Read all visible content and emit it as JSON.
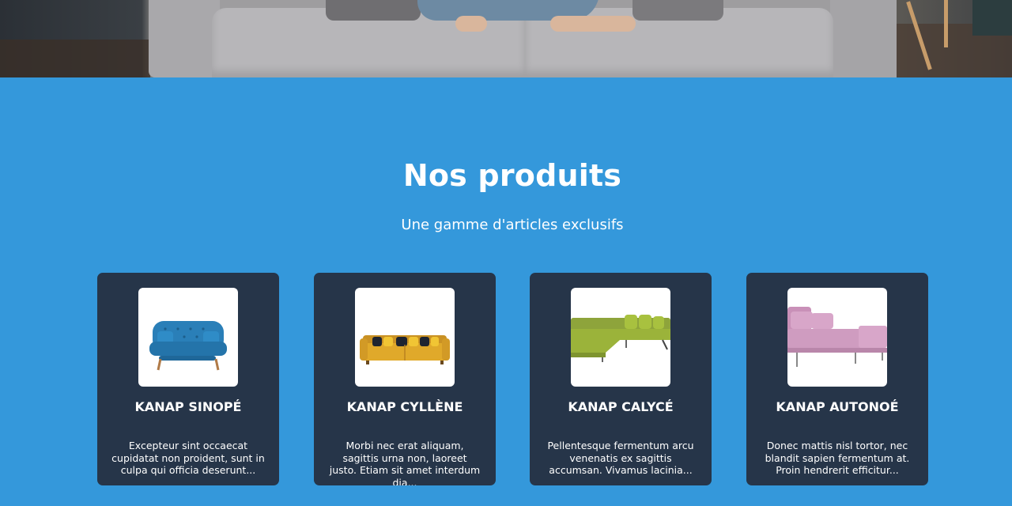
{
  "section": {
    "title": "Nos produits",
    "subtitle": "Une gamme d'articles exclusifs"
  },
  "products": [
    {
      "name": "KANAP SINOPÉ",
      "description": "Excepteur sint occaecat cupidatat non proident, sunt in culpa qui officia deserunt...",
      "image_icon": "blue-loveseat-icon",
      "color": "#2a7fb8"
    },
    {
      "name": "KANAP CYLLÈNE",
      "description": "Morbi nec erat aliquam, sagittis urna non, laoreet justo. Etiam sit amet interdum dia...",
      "image_icon": "yellow-sofa-icon",
      "color": "#e0a92a"
    },
    {
      "name": "KANAP CALYCÉ",
      "description": "Pellentesque fermentum arcu venenatis ex sagittis accumsan. Vivamus lacinia...",
      "image_icon": "green-sectional-sofa-icon",
      "color": "#9bb33a"
    },
    {
      "name": "KANAP AUTONOÉ",
      "description": "Donec mattis nisl tortor, nec blandit sapien fermentum at. Proin hendrerit efficitur...",
      "image_icon": "pink-chaise-sofa-icon",
      "color": "#cf9cc0"
    }
  ],
  "colors": {
    "background": "#3498db",
    "card": "#263549",
    "text": "#ffffff"
  }
}
